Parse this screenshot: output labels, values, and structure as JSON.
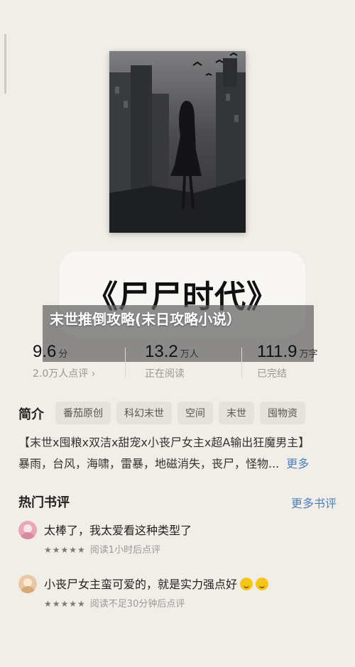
{
  "book": {
    "title": "《尸尸时代》",
    "overlay_title": "末世推倒攻略(末日攻略小说）"
  },
  "stats": [
    {
      "value": "9.6",
      "unit": "分",
      "sub": "2.0万人点评 ›"
    },
    {
      "value": "13.2",
      "unit": "万人",
      "sub": "正在阅读"
    },
    {
      "value": "111.9",
      "unit": "万字",
      "sub": "已完结"
    }
  ],
  "intro": {
    "heading": "简介",
    "tags": [
      "番茄原创",
      "科幻末世",
      "空间",
      "末世",
      "囤物资"
    ],
    "line1": "【末世x囤粮x双洁x甜宠x小丧尸女主x超A输出狂魔男主】",
    "line2": "暴雨，台风，海啸，雷暴，地磁消失，丧尸，怪物...",
    "more": "更多"
  },
  "reviews": {
    "heading": "热门书评",
    "more": "更多书评",
    "items": [
      {
        "text": "太棒了，我太爱看这种类型了",
        "stars": "★★★★★",
        "meta": "阅读1小时后点评",
        "avatar_color": "#e8a6b8",
        "emojis": 0
      },
      {
        "text": "小丧尸女主蛮可爱的，就是实力强点好",
        "stars": "★★★★★",
        "meta": "阅读不足30分钟后点评",
        "avatar_color": "#e9c9a3",
        "emojis": 2
      }
    ]
  },
  "colors": {
    "background": "#f1eee7",
    "link": "#4d7fbd",
    "tag_bg": "#e6e2da"
  },
  "icons": [
    "cover-image",
    "avatar",
    "star-icon",
    "emoji-icon"
  ]
}
